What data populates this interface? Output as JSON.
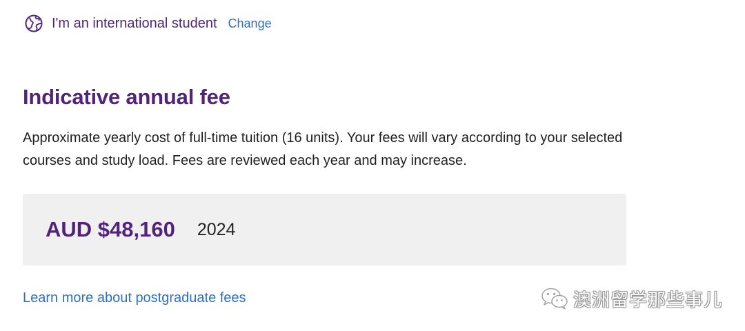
{
  "student": {
    "icon": "globe-icon",
    "label": "I'm an international student",
    "change_link": "Change"
  },
  "fees": {
    "heading": "Indicative annual fee",
    "description": "Approximate yearly cost of full-time tuition (16 units). Your fees will vary according to your selected courses and study load. Fees are reviewed each year and may increase.",
    "amount": "AUD $48,160",
    "year": "2024"
  },
  "links": {
    "learn_more": "Learn more about postgraduate fees"
  },
  "watermark": {
    "icon": "wechat-icon",
    "text": "澳洲留学那些事儿"
  },
  "colors": {
    "brand_purple": "#51247a",
    "link_blue": "#2f6fc4",
    "fee_box_bg": "#f0f0f0",
    "body_text": "#1f1f1f"
  }
}
